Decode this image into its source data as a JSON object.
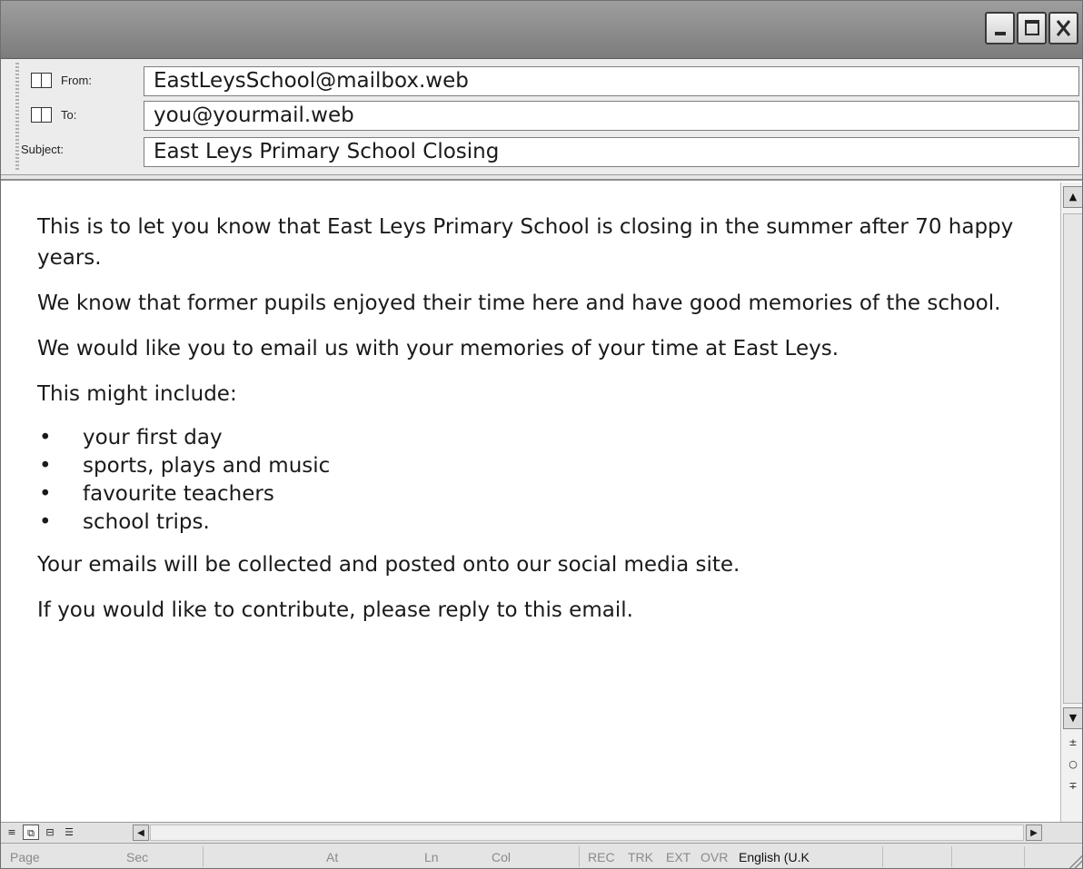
{
  "window": {
    "controls": {
      "minimize_icon": "minimize-icon",
      "maximize_icon": "maximize-icon",
      "close_icon": "close-icon"
    }
  },
  "header": {
    "from_label": "From:",
    "from_value": "EastLeysSchool@mailbox.web",
    "to_label": "To:",
    "to_value": "you@yourmail.web",
    "subject_label": "Subject:",
    "subject_value": "East Leys Primary School Closing",
    "address_book_icon": "address-book-icon"
  },
  "body": {
    "paragraphs": [
      "This is to let you know that East Leys Primary School is closing in the summer after 70 happy years.",
      "We know that former pupils enjoyed their time here and have good memories of the school.",
      "We would like you to email us with your memories of your time at East Leys.",
      "This might include:"
    ],
    "list": [
      "your first day",
      "sports, plays and music",
      "favourite teachers",
      "school trips."
    ],
    "closing": [
      "Your emails will be collected and posted onto our social media site.",
      "If you would like to contribute, please reply to this email."
    ]
  },
  "scrollbars": {
    "up_icon": "▲",
    "down_icon": "▼",
    "prev_icon": "±",
    "browse_icon": "○",
    "next_icon": "∓",
    "left_icon": "◀",
    "right_icon": "▶"
  },
  "view_buttons": [
    "≡",
    "⧉",
    "⊟",
    "☰"
  ],
  "statusbar": {
    "page": "Page",
    "sec": "Sec",
    "at": "At",
    "ln": "Ln",
    "col": "Col",
    "rec": "REC",
    "trk": "TRK",
    "ext": "EXT",
    "ovr": "OVR",
    "language": "English (U.K"
  },
  "colors": {
    "titlebar": "#8c8c8c",
    "background": "#e6e6e6",
    "field_bg": "#ffffff"
  }
}
